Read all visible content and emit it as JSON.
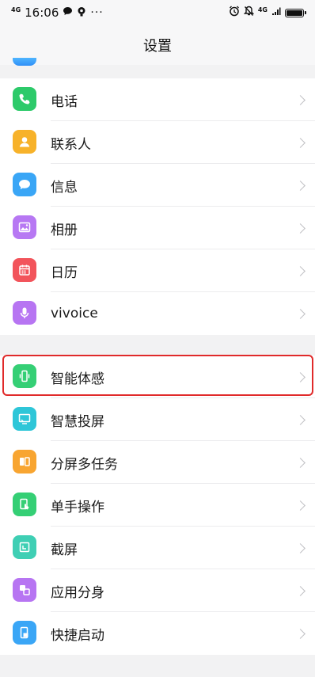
{
  "status_bar": {
    "network_left": "4G",
    "time": "16:06",
    "icons_left": [
      "chat-bubble-icon",
      "notification-icon"
    ],
    "more": "···",
    "icons_right": [
      "alarm-icon",
      "mute-bell-icon"
    ],
    "network_right": "4G"
  },
  "header": {
    "title": "设置"
  },
  "group1": [
    {
      "label": "电话",
      "icon": "phone-icon",
      "color": "#2dca6a"
    },
    {
      "label": "联系人",
      "icon": "contact-icon",
      "color": "#f7b22a"
    },
    {
      "label": "信息",
      "icon": "message-icon",
      "color": "#3aa6f6"
    },
    {
      "label": "相册",
      "icon": "album-icon",
      "color": "#b778f3"
    },
    {
      "label": "日历",
      "icon": "calendar-icon",
      "color": "#f2545b"
    },
    {
      "label": "vivoice",
      "icon": "microphone-icon",
      "color": "#b775f2"
    }
  ],
  "group2": [
    {
      "label": "智能体感",
      "icon": "phone-vibrate-icon",
      "color": "#35cf75"
    },
    {
      "label": "智慧投屏",
      "icon": "screen-cast-icon",
      "color": "#2ec6d8"
    },
    {
      "label": "分屏多任务",
      "icon": "split-screen-icon",
      "color": "#f8a531"
    },
    {
      "label": "单手操作",
      "icon": "one-hand-icon",
      "color": "#35cf75"
    },
    {
      "label": "截屏",
      "icon": "screenshot-icon",
      "color": "#3fcfb4"
    },
    {
      "label": "应用分身",
      "icon": "app-clone-icon",
      "color": "#b775f2"
    },
    {
      "label": "快捷启动",
      "icon": "quick-launch-icon",
      "color": "#3aa6f6"
    }
  ],
  "highlight_color": "#e02a2a"
}
